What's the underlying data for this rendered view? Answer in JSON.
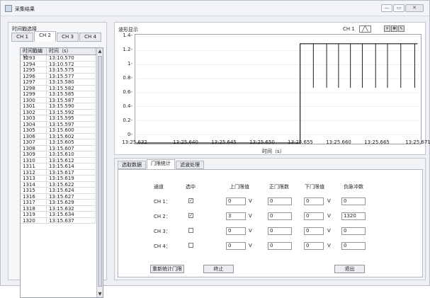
{
  "window": {
    "title": "采集结果",
    "btn_min": "—",
    "btn_max": "▭",
    "btn_close": "✕"
  },
  "left": {
    "label": "时间戳选择",
    "tabs": [
      "CH 1",
      "CH 2",
      "CH 3",
      "CH 4"
    ],
    "active_tab": 1,
    "columns": [
      "时间戳编号",
      "时间（s）"
    ],
    "rows": [
      [
        "1293",
        "13:10.570"
      ],
      [
        "1294",
        "13:10.572"
      ],
      [
        "1295",
        "13:15.575"
      ],
      [
        "1296",
        "13:15.577"
      ],
      [
        "1297",
        "13:15.580"
      ],
      [
        "1298",
        "13:15.582"
      ],
      [
        "1299",
        "13:15.585"
      ],
      [
        "1300",
        "13:15.587"
      ],
      [
        "1301",
        "13:15.590"
      ],
      [
        "1302",
        "13:15.592"
      ],
      [
        "1303",
        "13:15.595"
      ],
      [
        "1304",
        "13:15.597"
      ],
      [
        "1305",
        "13:15.600"
      ],
      [
        "1306",
        "13:15.602"
      ],
      [
        "1307",
        "13:15.605"
      ],
      [
        "1308",
        "13:15.607"
      ],
      [
        "1309",
        "13:15.610"
      ],
      [
        "1310",
        "13:15.612"
      ],
      [
        "1311",
        "13:15.614"
      ],
      [
        "1312",
        "13:15.617"
      ],
      [
        "1313",
        "13:15.619"
      ],
      [
        "1314",
        "13:15.622"
      ],
      [
        "1315",
        "13:15.624"
      ],
      [
        "1316",
        "13:15.627"
      ],
      [
        "1317",
        "13:15.629"
      ],
      [
        "1318",
        "13:15.632"
      ],
      [
        "1319",
        "13:15.634"
      ],
      [
        "1320",
        "13:15.637"
      ]
    ]
  },
  "wave": {
    "label": "波形显示",
    "legend": "CH 1",
    "xlabel": "时间（s）",
    "yticks": [
      "1.4-",
      "1.2-",
      "1-",
      "0.8-",
      "0.6-",
      "0.4-",
      "0.2-",
      "0-"
    ],
    "xticks": [
      "13:25.632",
      "13:25.640",
      "13:25.645",
      "13:25.650",
      "13:25.655",
      "13:25.660",
      "13:25.665",
      "13:25.671"
    ],
    "series_color": "#1a1a1a"
  },
  "bottom": {
    "tabs": [
      "选取数据",
      "门限统计",
      "滤波处理"
    ],
    "active_tab": 1,
    "headers": {
      "channel": "通道",
      "selected": "选中",
      "upper": "上门限值",
      "upper_count": "正门限数",
      "lower": "下门限值",
      "neg_pulse": "负脉冲数"
    },
    "channels": [
      {
        "name": "CH 1：",
        "checked": "✓",
        "upper": "0",
        "upper_unit": "V",
        "upper_count": "0",
        "lower": "0",
        "lower_unit": "V",
        "neg": "0"
      },
      {
        "name": "CH 2：",
        "checked": "✓",
        "upper": "3",
        "upper_unit": "V",
        "upper_count": "0",
        "lower": "0",
        "lower_unit": "V",
        "neg": "1320"
      },
      {
        "name": "CH 3：",
        "checked": "",
        "upper": "0",
        "upper_unit": "V",
        "upper_count": "0",
        "lower": "0",
        "lower_unit": "V",
        "neg": "0"
      },
      {
        "name": "CH 4：",
        "checked": "",
        "upper": "0",
        "upper_unit": "V",
        "upper_count": "0",
        "lower": "0",
        "lower_unit": "V",
        "neg": "0"
      }
    ],
    "btn_recount": "重新统计门限",
    "btn_stop": "终止",
    "btn_exit": "退出"
  }
}
